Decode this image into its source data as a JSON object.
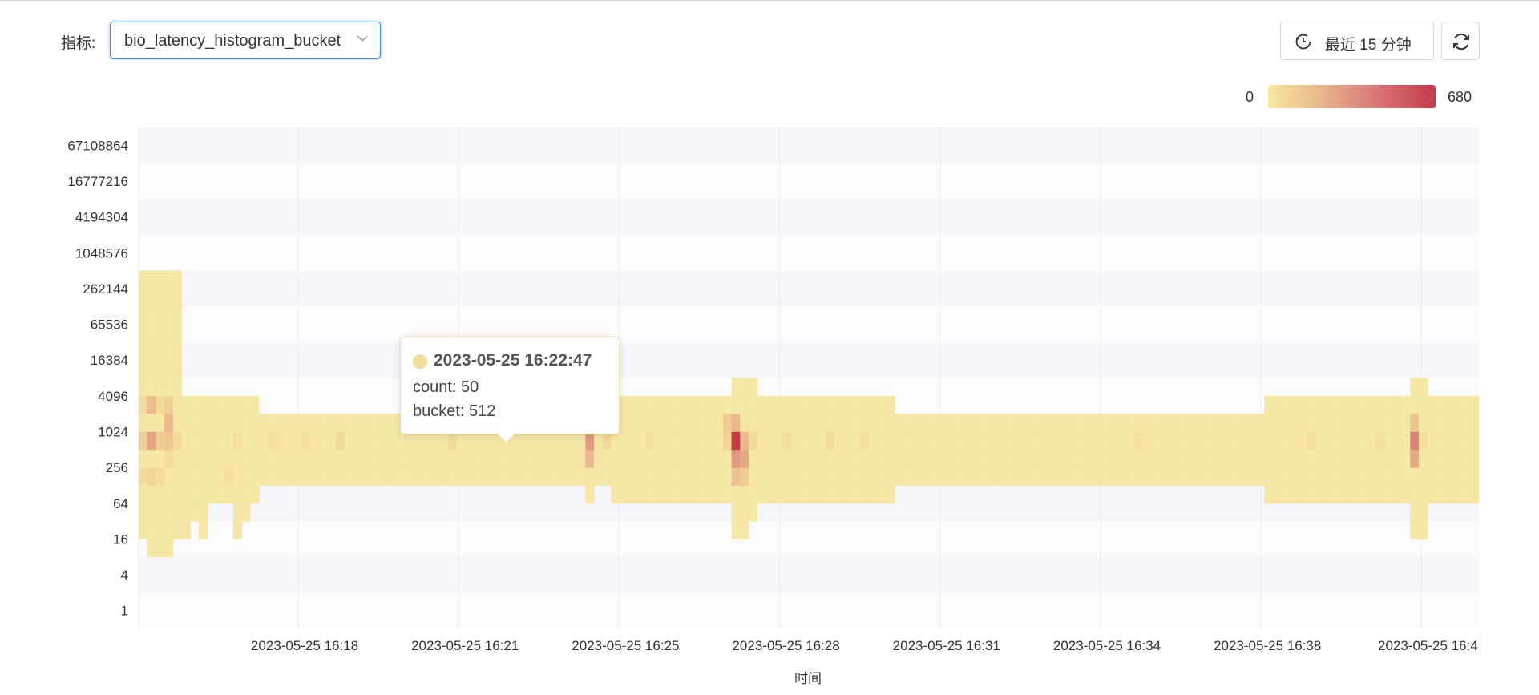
{
  "toolbar": {
    "metric_label": "指标:",
    "metric_value": "bio_latency_histogram_bucket",
    "time_range_label": "最近 15 分钟",
    "icons": {
      "time": "history-clock-icon",
      "refresh": "refresh-icon",
      "dropdown": "chevron-down-icon"
    }
  },
  "legend": {
    "min": "0",
    "max": "680",
    "colors": [
      "#f6e8a0",
      "#e8b38a",
      "#d97277",
      "#c33b4a"
    ]
  },
  "tooltip": {
    "title": "2023-05-25 16:22:47",
    "count_text": "count: 50",
    "bucket_text": "bucket: 512",
    "dot_color": "#f2dc96"
  },
  "chart_data": {
    "type": "heatmap",
    "xlabel": "时间",
    "ylabel": "",
    "y_categories": [
      "1",
      "4",
      "16",
      "64",
      "256",
      "1024",
      "4096",
      "16384",
      "65536",
      "262144",
      "1048576",
      "4194304",
      "16777216",
      "67108864"
    ],
    "x_tick_labels": [
      "2023-05-25 16:18",
      "2023-05-25 16:21",
      "2023-05-25 16:25",
      "2023-05-25 16:28",
      "2023-05-25 16:31",
      "2023-05-25 16:34",
      "2023-05-25 16:38",
      "2023-05-25 16:4"
    ],
    "value_range": [
      0,
      680
    ],
    "grid": true,
    "columns_spec": [
      {
        "c": 0,
        "b": [
          5,
          19
        ],
        "hot": [
          [
            8,
            50
          ],
          [
            10,
            100
          ],
          [
            12,
            50
          ]
        ]
      },
      {
        "c": 1,
        "b": [
          4,
          19
        ],
        "hot": [
          [
            8,
            80
          ],
          [
            10,
            280
          ],
          [
            12,
            180
          ]
        ]
      },
      {
        "c": 2,
        "b": [
          4,
          19
        ],
        "hot": [
          [
            8,
            50
          ],
          [
            10,
            120
          ],
          [
            12,
            60
          ]
        ]
      },
      {
        "c": 3,
        "b": [
          4,
          19
        ],
        "hot": [
          [
            9,
            50
          ],
          [
            10,
            150
          ],
          [
            11,
            200
          ],
          [
            12,
            100
          ]
        ]
      },
      {
        "c": 4,
        "b": [
          5,
          19
        ],
        "hot": [
          [
            10,
            60
          ]
        ]
      },
      {
        "c": 5,
        "b": [
          5,
          12
        ]
      },
      {
        "c": 6,
        "b": [
          6,
          12
        ]
      },
      {
        "c": 7,
        "b": [
          5,
          12
        ]
      },
      {
        "c": 8,
        "b": [
          7,
          12
        ]
      },
      {
        "c": 9,
        "b": [
          7,
          12
        ]
      },
      {
        "c": 10,
        "b": [
          7,
          12
        ],
        "hot": [
          [
            8,
            40
          ]
        ]
      },
      {
        "c": 11,
        "b": [
          5,
          12
        ],
        "hot": [
          [
            10,
            40
          ]
        ]
      },
      {
        "c": 12,
        "b": [
          6,
          12
        ]
      },
      {
        "c": 13,
        "b": [
          7,
          12
        ]
      },
      {
        "c": 14,
        "b": [
          8,
          11
        ]
      },
      {
        "c": 15,
        "b": [
          8,
          11
        ],
        "hot": [
          [
            10,
            30
          ]
        ]
      },
      {
        "c": 16,
        "b": [
          8,
          11
        ],
        "hot": [
          [
            10,
            20
          ]
        ]
      },
      {
        "c": 17,
        "b": [
          8,
          11
        ]
      },
      {
        "c": 18,
        "b": [
          8,
          11
        ]
      },
      {
        "c": 19,
        "b": [
          8,
          11
        ],
        "hot": [
          [
            10,
            40
          ]
        ]
      },
      {
        "c": 20,
        "b": [
          8,
          11
        ]
      },
      {
        "c": 21,
        "b": [
          8,
          11
        ]
      },
      {
        "c": 22,
        "b": [
          8,
          11
        ]
      },
      {
        "c": 23,
        "b": [
          8,
          11
        ],
        "hot": [
          [
            10,
            60
          ]
        ]
      },
      {
        "c": 24,
        "b": [
          8,
          11
        ]
      },
      {
        "c": 25,
        "b": [
          8,
          11
        ]
      },
      {
        "c": 26,
        "b": [
          8,
          11
        ]
      },
      {
        "c": 27,
        "b": [
          8,
          11
        ]
      },
      {
        "c": 28,
        "b": [
          8,
          11
        ]
      },
      {
        "c": 29,
        "b": [
          8,
          11
        ]
      },
      {
        "c": 30,
        "b": [
          8,
          11
        ]
      },
      {
        "c": 31,
        "b": [
          8,
          11
        ]
      },
      {
        "c": 32,
        "b": [
          8,
          11
        ]
      },
      {
        "c": 33,
        "b": [
          8,
          11
        ]
      },
      {
        "c": 34,
        "b": [
          8,
          11
        ]
      },
      {
        "c": 35,
        "b": [
          8,
          11
        ]
      },
      {
        "c": 36,
        "b": [
          8,
          11
        ],
        "hot": [
          [
            10,
            50
          ]
        ]
      },
      {
        "c": 37,
        "b": [
          8,
          11
        ]
      },
      {
        "c": 38,
        "b": [
          8,
          11
        ]
      },
      {
        "c": 39,
        "b": [
          8,
          11
        ]
      },
      {
        "c": 40,
        "b": [
          8,
          11
        ]
      },
      {
        "c": 41,
        "b": [
          8,
          11
        ]
      },
      {
        "c": 42,
        "b": [
          8,
          11
        ]
      },
      {
        "c": 43,
        "b": [
          8,
          11
        ]
      },
      {
        "c": 44,
        "b": [
          8,
          11
        ]
      },
      {
        "c": 45,
        "b": [
          8,
          11
        ]
      },
      {
        "c": 46,
        "b": [
          8,
          11
        ]
      },
      {
        "c": 47,
        "b": [
          8,
          11
        ]
      },
      {
        "c": 48,
        "b": [
          8,
          11
        ]
      },
      {
        "c": 49,
        "b": [
          8,
          11
        ]
      },
      {
        "c": 50,
        "b": [
          8,
          11
        ]
      },
      {
        "c": 51,
        "b": [
          8,
          11
        ]
      },
      {
        "c": 52,
        "b": [
          7,
          12
        ],
        "hot": [
          [
            9,
            200
          ],
          [
            10,
            300
          ],
          [
            11,
            200
          ]
        ]
      },
      {
        "c": 53,
        "b": [
          8,
          11
        ]
      },
      {
        "c": 54,
        "b": [
          8,
          11
        ],
        "hot": [
          [
            10,
            60
          ]
        ]
      },
      {
        "c": 55,
        "b": [
          7,
          12
        ]
      },
      {
        "c": 56,
        "b": [
          7,
          12
        ]
      },
      {
        "c": 57,
        "b": [
          7,
          12
        ]
      },
      {
        "c": 58,
        "b": [
          7,
          12
        ]
      },
      {
        "c": 59,
        "b": [
          7,
          12
        ],
        "hot": [
          [
            10,
            40
          ]
        ]
      },
      {
        "c": 60,
        "b": [
          7,
          12
        ]
      },
      {
        "c": 61,
        "b": [
          7,
          12
        ]
      },
      {
        "c": 62,
        "b": [
          7,
          12
        ]
      },
      {
        "c": 63,
        "b": [
          7,
          12
        ]
      },
      {
        "c": 64,
        "b": [
          7,
          12
        ]
      },
      {
        "c": 65,
        "b": [
          7,
          12
        ]
      },
      {
        "c": 66,
        "b": [
          7,
          12
        ]
      },
      {
        "c": 67,
        "b": [
          7,
          12
        ]
      },
      {
        "c": 68,
        "b": [
          7,
          12
        ],
        "hot": [
          [
            10,
            80
          ],
          [
            11,
            120
          ]
        ]
      },
      {
        "c": 69,
        "b": [
          5,
          13
        ],
        "hot": [
          [
            8,
            160
          ],
          [
            9,
            320
          ],
          [
            10,
            680
          ],
          [
            11,
            200
          ]
        ]
      },
      {
        "c": 70,
        "b": [
          5,
          13
        ],
        "hot": [
          [
            8,
            120
          ],
          [
            9,
            260
          ],
          [
            10,
            200
          ]
        ]
      },
      {
        "c": 71,
        "b": [
          6,
          13
        ],
        "hot": [
          [
            10,
            60
          ]
        ]
      },
      {
        "c": 72,
        "b": [
          7,
          12
        ]
      },
      {
        "c": 73,
        "b": [
          7,
          12
        ]
      },
      {
        "c": 74,
        "b": [
          7,
          12
        ]
      },
      {
        "c": 75,
        "b": [
          7,
          12
        ],
        "hot": [
          [
            10,
            40
          ]
        ]
      },
      {
        "c": 76,
        "b": [
          7,
          12
        ]
      },
      {
        "c": 77,
        "b": [
          7,
          12
        ]
      },
      {
        "c": 78,
        "b": [
          7,
          12
        ]
      },
      {
        "c": 79,
        "b": [
          7,
          12
        ]
      },
      {
        "c": 80,
        "b": [
          7,
          12
        ],
        "hot": [
          [
            10,
            50
          ]
        ]
      },
      {
        "c": 81,
        "b": [
          7,
          12
        ]
      },
      {
        "c": 82,
        "b": [
          7,
          12
        ]
      },
      {
        "c": 83,
        "b": [
          7,
          12
        ]
      },
      {
        "c": 84,
        "b": [
          7,
          12
        ],
        "hot": [
          [
            10,
            40
          ]
        ]
      },
      {
        "c": 85,
        "b": [
          7,
          12
        ]
      },
      {
        "c": 86,
        "b": [
          7,
          12
        ]
      },
      {
        "c": 87,
        "b": [
          7,
          12
        ]
      },
      {
        "c": 88,
        "b": [
          8,
          11
        ]
      },
      {
        "c": 89,
        "b": [
          8,
          11
        ]
      },
      {
        "c": 90,
        "b": [
          8,
          11
        ]
      },
      {
        "c": 91,
        "b": [
          8,
          11
        ]
      },
      {
        "c": 92,
        "b": [
          8,
          11
        ]
      },
      {
        "c": 93,
        "b": [
          8,
          11
        ]
      },
      {
        "c": 94,
        "b": [
          8,
          11
        ]
      },
      {
        "c": 95,
        "b": [
          8,
          11
        ]
      },
      {
        "c": 96,
        "b": [
          8,
          11
        ]
      },
      {
        "c": 97,
        "b": [
          8,
          11
        ]
      },
      {
        "c": 98,
        "b": [
          8,
          11
        ]
      },
      {
        "c": 99,
        "b": [
          8,
          11
        ]
      },
      {
        "c": 100,
        "b": [
          8,
          11
        ]
      },
      {
        "c": 101,
        "b": [
          8,
          11
        ]
      },
      {
        "c": 102,
        "b": [
          8,
          11
        ]
      },
      {
        "c": 103,
        "b": [
          8,
          11
        ]
      },
      {
        "c": 104,
        "b": [
          8,
          11
        ]
      },
      {
        "c": 105,
        "b": [
          8,
          11
        ]
      },
      {
        "c": 106,
        "b": [
          8,
          11
        ]
      },
      {
        "c": 107,
        "b": [
          8,
          11
        ]
      },
      {
        "c": 108,
        "b": [
          8,
          11
        ]
      },
      {
        "c": 109,
        "b": [
          8,
          11
        ]
      },
      {
        "c": 110,
        "b": [
          8,
          11
        ]
      },
      {
        "c": 111,
        "b": [
          8,
          11
        ]
      },
      {
        "c": 112,
        "b": [
          8,
          11
        ]
      },
      {
        "c": 113,
        "b": [
          8,
          11
        ]
      },
      {
        "c": 114,
        "b": [
          8,
          11
        ]
      },
      {
        "c": 115,
        "b": [
          8,
          11
        ]
      },
      {
        "c": 116,
        "b": [
          8,
          11
        ],
        "hot": [
          [
            10,
            30
          ]
        ]
      },
      {
        "c": 117,
        "b": [
          8,
          11
        ]
      },
      {
        "c": 118,
        "b": [
          8,
          11
        ]
      },
      {
        "c": 119,
        "b": [
          8,
          11
        ]
      },
      {
        "c": 120,
        "b": [
          8,
          11
        ]
      },
      {
        "c": 121,
        "b": [
          8,
          11
        ]
      },
      {
        "c": 122,
        "b": [
          8,
          11
        ]
      },
      {
        "c": 123,
        "b": [
          8,
          11
        ]
      },
      {
        "c": 124,
        "b": [
          8,
          11
        ]
      },
      {
        "c": 125,
        "b": [
          8,
          11
        ]
      },
      {
        "c": 126,
        "b": [
          8,
          11
        ]
      },
      {
        "c": 127,
        "b": [
          8,
          11
        ]
      },
      {
        "c": 128,
        "b": [
          8,
          11
        ]
      },
      {
        "c": 129,
        "b": [
          8,
          11
        ]
      },
      {
        "c": 130,
        "b": [
          8,
          11
        ]
      },
      {
        "c": 131,
        "b": [
          7,
          12
        ]
      },
      {
        "c": 132,
        "b": [
          7,
          12
        ]
      },
      {
        "c": 133,
        "b": [
          7,
          12
        ]
      },
      {
        "c": 134,
        "b": [
          7,
          12
        ]
      },
      {
        "c": 135,
        "b": [
          7,
          12
        ]
      },
      {
        "c": 136,
        "b": [
          7,
          12
        ],
        "hot": [
          [
            10,
            40
          ]
        ]
      },
      {
        "c": 137,
        "b": [
          7,
          12
        ]
      },
      {
        "c": 138,
        "b": [
          7,
          12
        ]
      },
      {
        "c": 139,
        "b": [
          7,
          12
        ]
      },
      {
        "c": 140,
        "b": [
          7,
          12
        ]
      },
      {
        "c": 141,
        "b": [
          7,
          12
        ]
      },
      {
        "c": 142,
        "b": [
          7,
          12
        ]
      },
      {
        "c": 143,
        "b": [
          7,
          12
        ]
      },
      {
        "c": 144,
        "b": [
          7,
          12
        ],
        "hot": [
          [
            10,
            40
          ]
        ]
      },
      {
        "c": 145,
        "b": [
          7,
          12
        ]
      },
      {
        "c": 146,
        "b": [
          7,
          12
        ]
      },
      {
        "c": 147,
        "b": [
          7,
          12
        ]
      },
      {
        "c": 148,
        "b": [
          5,
          13
        ],
        "hot": [
          [
            9,
            260
          ],
          [
            10,
            400
          ],
          [
            11,
            150
          ]
        ]
      },
      {
        "c": 149,
        "b": [
          5,
          13
        ],
        "hot": [
          [
            10,
            40
          ]
        ]
      },
      {
        "c": 150,
        "b": [
          7,
          12
        ]
      },
      {
        "c": 151,
        "b": [
          7,
          12
        ]
      },
      {
        "c": 152,
        "b": [
          7,
          12
        ]
      },
      {
        "c": 153,
        "b": [
          7,
          12
        ]
      },
      {
        "c": 154,
        "b": [
          7,
          12
        ]
      },
      {
        "c": 155,
        "b": [
          7,
          12
        ]
      }
    ]
  }
}
